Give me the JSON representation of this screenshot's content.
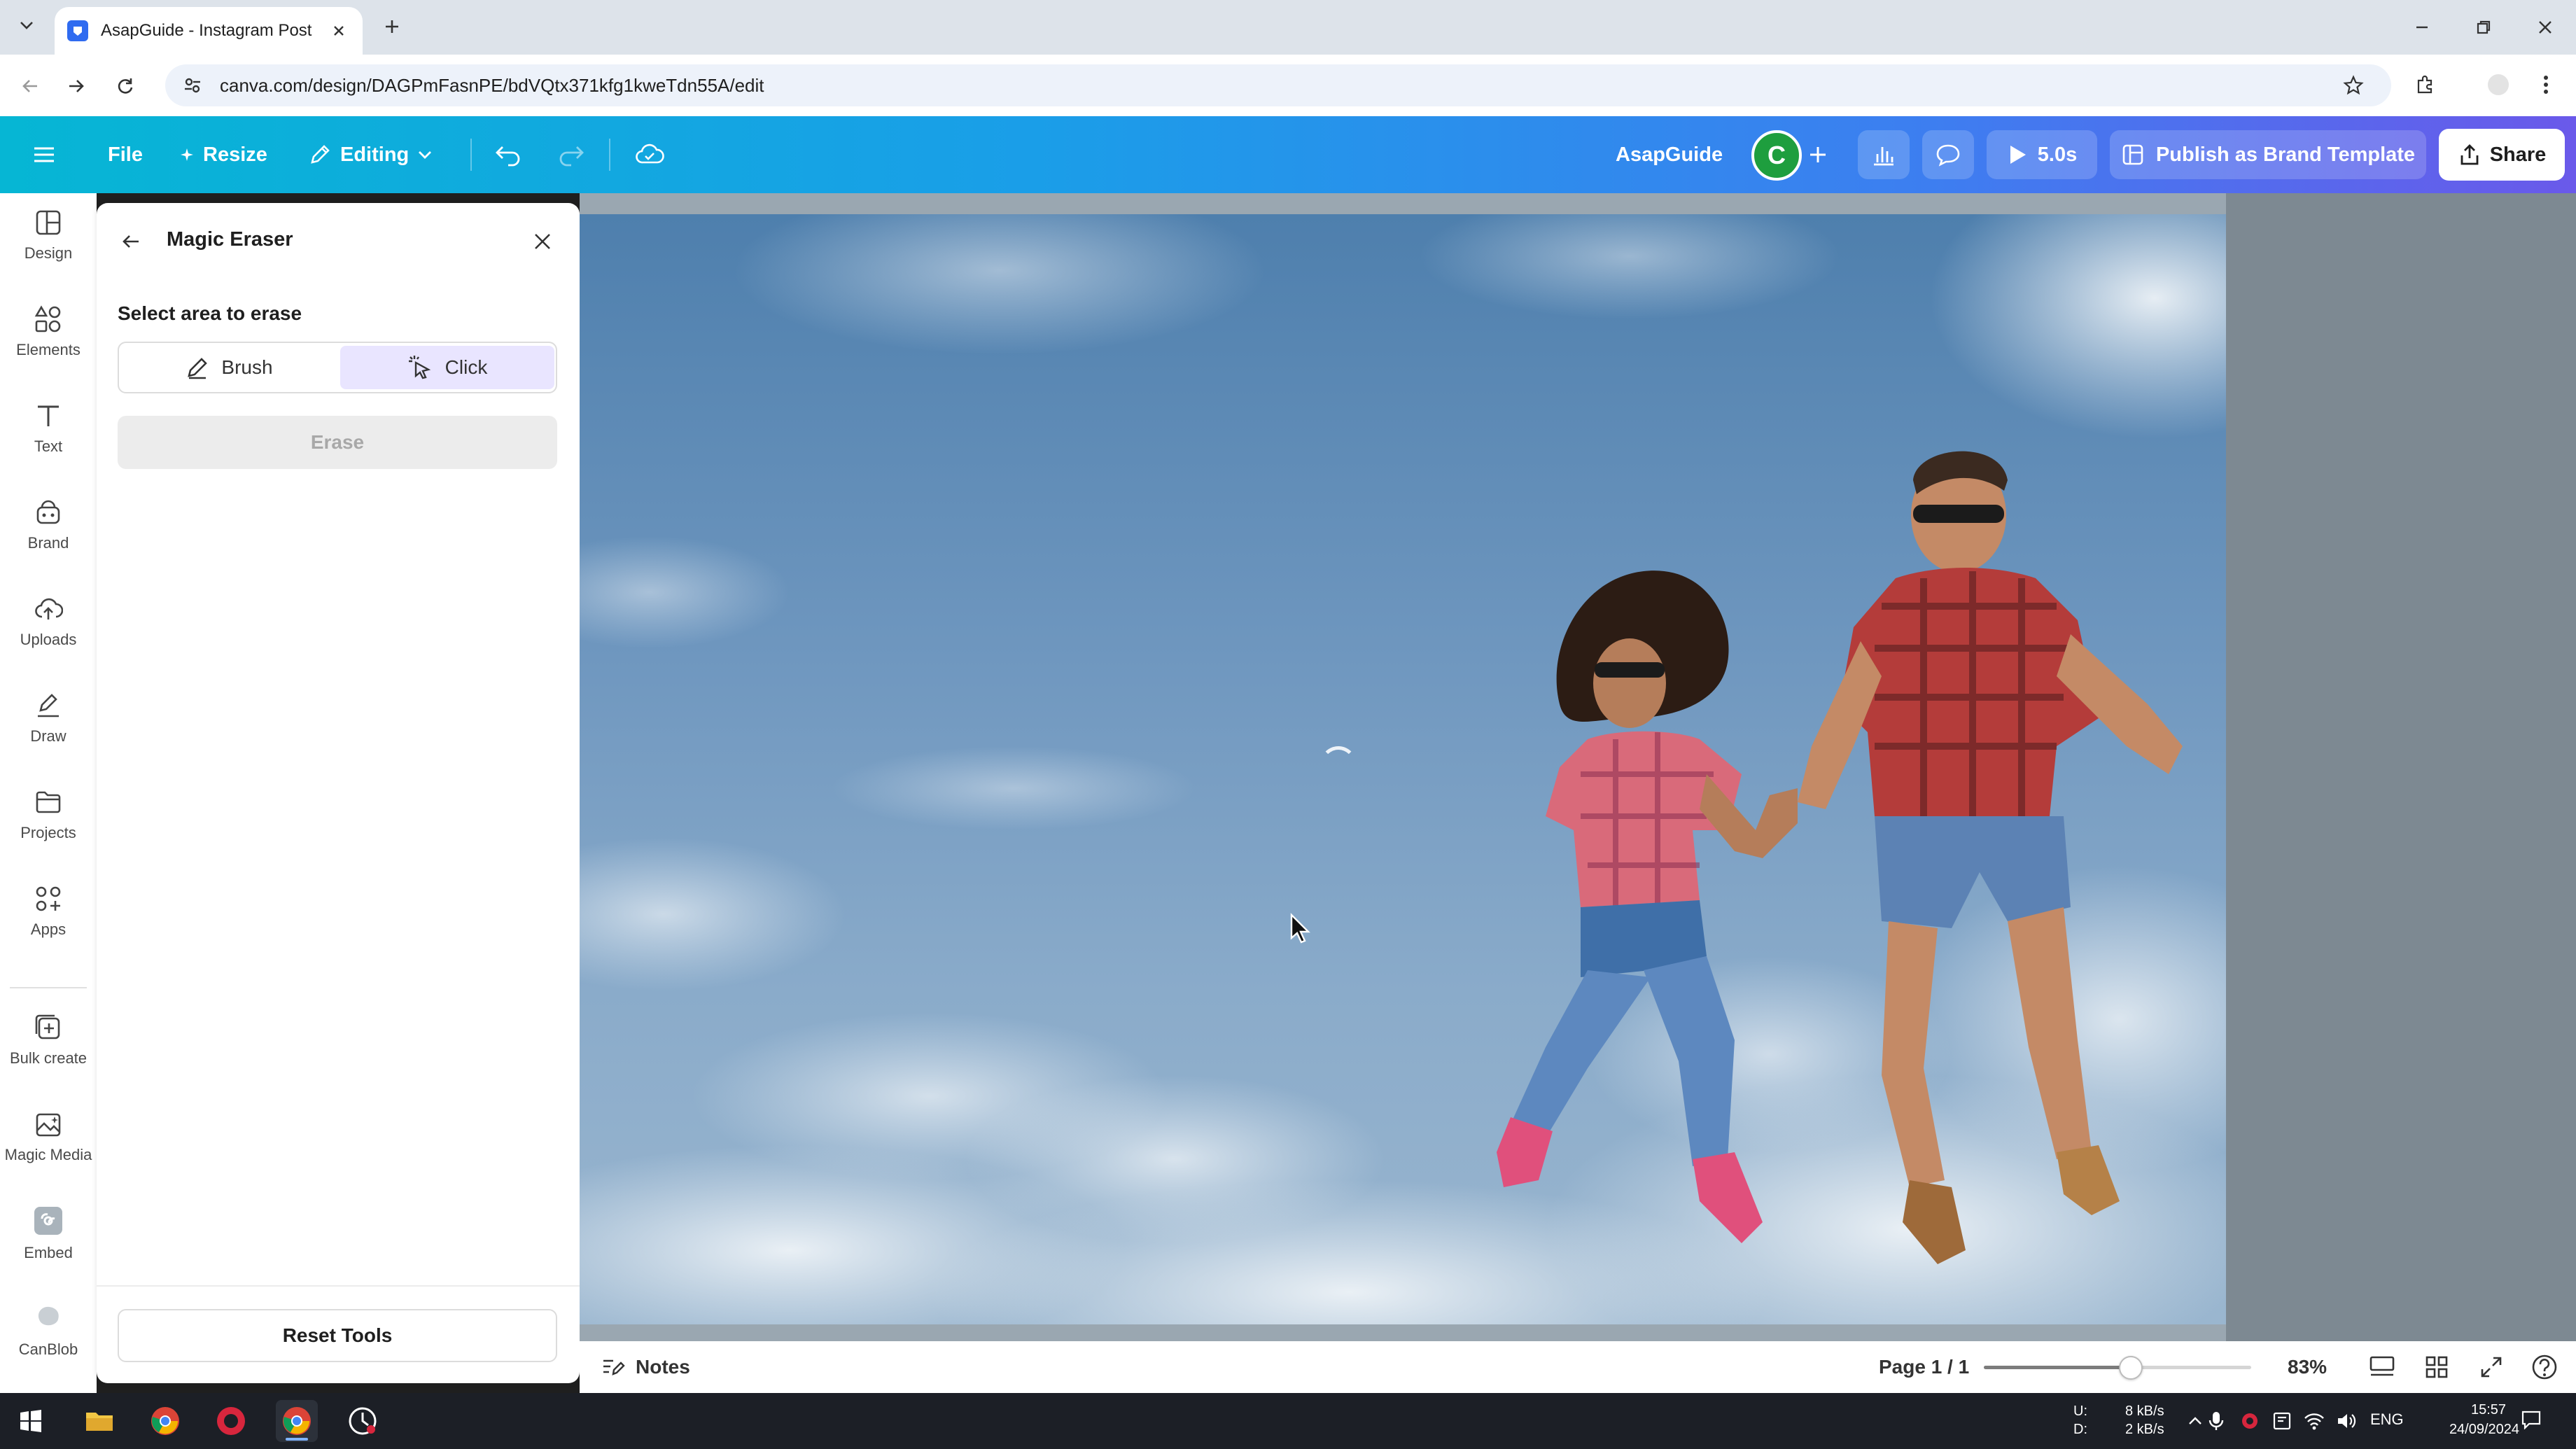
{
  "browser": {
    "tab_title": "AsapGuide - Instagram Post",
    "url": "canva.com/design/DAGPmFasnPE/bdVQtx371kfg1kweTdn55A/edit"
  },
  "topbar": {
    "file": "File",
    "resize": "Resize",
    "editing": "Editing",
    "team_name": "AsapGuide",
    "avatar_initial": "C",
    "play_duration": "5.0s",
    "publish": "Publish as Brand Template",
    "share": "Share"
  },
  "rail": {
    "items": [
      {
        "label": "Design",
        "icon": "design-icon"
      },
      {
        "label": "Elements",
        "icon": "elements-icon"
      },
      {
        "label": "Text",
        "icon": "text-icon"
      },
      {
        "label": "Brand",
        "icon": "brand-icon"
      },
      {
        "label": "Uploads",
        "icon": "uploads-icon"
      },
      {
        "label": "Draw",
        "icon": "draw-icon"
      },
      {
        "label": "Projects",
        "icon": "projects-icon"
      },
      {
        "label": "Apps",
        "icon": "apps-icon"
      },
      {
        "label": "Bulk create",
        "icon": "bulk-create-icon"
      },
      {
        "label": "Magic Media",
        "icon": "magic-media-icon"
      },
      {
        "label": "Embed",
        "icon": "embed-icon"
      },
      {
        "label": "CanBlob",
        "icon": "canblob-icon"
      }
    ]
  },
  "panel": {
    "title": "Magic Eraser",
    "section_label": "Select area to erase",
    "brush": "Brush",
    "click": "Click",
    "selected_mode": "Click",
    "erase": "Erase",
    "reset": "Reset Tools"
  },
  "bottom": {
    "notes": "Notes",
    "page": "Page 1 / 1",
    "zoom": "83%",
    "zoom_level": 0.55
  },
  "taskbar": {
    "net_up_label": "U:",
    "net_down_label": "D:",
    "net_up": "8 kB/s",
    "net_down": "2 kB/s",
    "lang": "ENG",
    "time": "15:57",
    "date": "24/09/2024"
  },
  "colors": {
    "accent": "#7d2ae8",
    "gradient_start": "#06b6d4",
    "gradient_end": "#6a59ea",
    "avatar": "#1e9e3e"
  }
}
